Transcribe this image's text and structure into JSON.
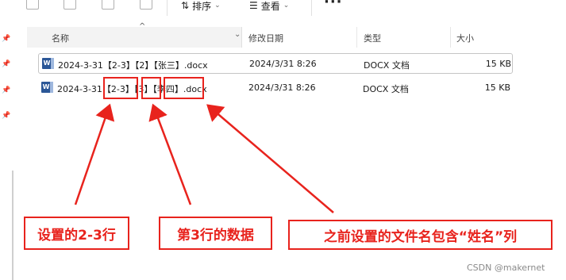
{
  "toolbar": {
    "sort_label": "排序",
    "view_label": "查看",
    "more_label": "···"
  },
  "columns": {
    "name": "名称",
    "modified": "修改日期",
    "type": "类型",
    "size": "大小"
  },
  "files": [
    {
      "name": "2024-3-31【2-3】【2】【张三】.docx",
      "modified": "2024/3/31 8:26",
      "type": "DOCX 文档",
      "size": "15 KB"
    },
    {
      "name_parts": [
        "2024-3-31",
        "【2-3】",
        "【3】",
        "【李四】",
        ".docx"
      ],
      "modified": "2024/3/31 8:26",
      "type": "DOCX 文档",
      "size": "15 KB"
    }
  ],
  "annotations": {
    "label_rows": "设置的2-3行",
    "label_data": "第3行的数据",
    "label_name": "之前设置的文件名包含“姓名”列",
    "color": "#e8231d"
  },
  "watermark": "CSDN @makernet"
}
